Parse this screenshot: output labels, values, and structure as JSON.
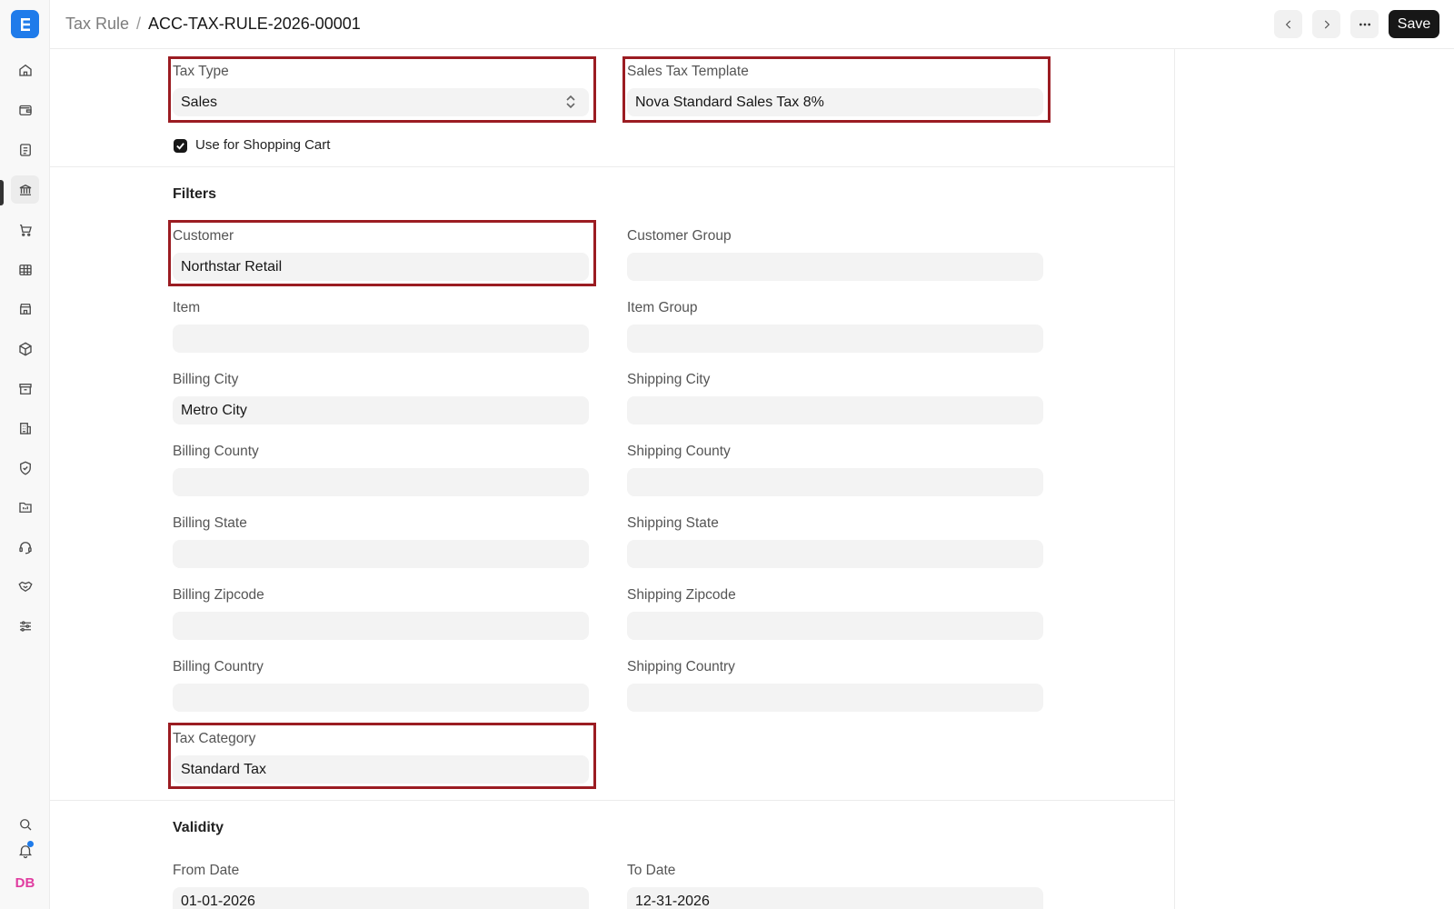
{
  "header": {
    "breadcrumb_parent": "Tax Rule",
    "breadcrumb_separator": "/",
    "breadcrumb_current": "ACC-TAX-RULE-2026-00001",
    "save_label": "Save"
  },
  "sidebar": {
    "logo_letter": "E",
    "avatar_initials": "DB",
    "items": [
      "home-icon",
      "wallet-icon",
      "document-icon",
      "bank-icon",
      "cart-icon",
      "table-icon",
      "store-icon",
      "package-icon",
      "archive-icon",
      "building-icon",
      "shield-icon",
      "folder-icon",
      "headset-icon",
      "handshake-icon",
      "sliders-icon"
    ]
  },
  "form": {
    "tax_type": {
      "label": "Tax Type",
      "value": "Sales"
    },
    "sales_tax_template": {
      "label": "Sales Tax Template",
      "value": "Nova Standard Sales Tax 8%"
    },
    "shopping_cart": {
      "label": "Use for Shopping Cart",
      "checked": true
    },
    "filters_title": "Filters",
    "customer": {
      "label": "Customer",
      "value": "Northstar Retail"
    },
    "customer_group": {
      "label": "Customer Group",
      "value": ""
    },
    "item": {
      "label": "Item",
      "value": ""
    },
    "item_group": {
      "label": "Item Group",
      "value": ""
    },
    "billing_city": {
      "label": "Billing City",
      "value": "Metro City"
    },
    "shipping_city": {
      "label": "Shipping City",
      "value": ""
    },
    "billing_county": {
      "label": "Billing County",
      "value": ""
    },
    "shipping_county": {
      "label": "Shipping County",
      "value": ""
    },
    "billing_state": {
      "label": "Billing State",
      "value": ""
    },
    "shipping_state": {
      "label": "Shipping State",
      "value": ""
    },
    "billing_zipcode": {
      "label": "Billing Zipcode",
      "value": ""
    },
    "shipping_zipcode": {
      "label": "Shipping Zipcode",
      "value": ""
    },
    "billing_country": {
      "label": "Billing Country",
      "value": ""
    },
    "shipping_country": {
      "label": "Shipping Country",
      "value": ""
    },
    "tax_category": {
      "label": "Tax Category",
      "value": "Standard Tax"
    },
    "validity_title": "Validity",
    "from_date": {
      "label": "From Date",
      "value": "01-01-2026"
    },
    "to_date": {
      "label": "To Date",
      "value": "12-31-2026"
    }
  },
  "colors": {
    "accent": "#1f7bea",
    "highlight": "#9b1c22",
    "primary_button": "#171717",
    "avatar": "#e03ca0"
  }
}
